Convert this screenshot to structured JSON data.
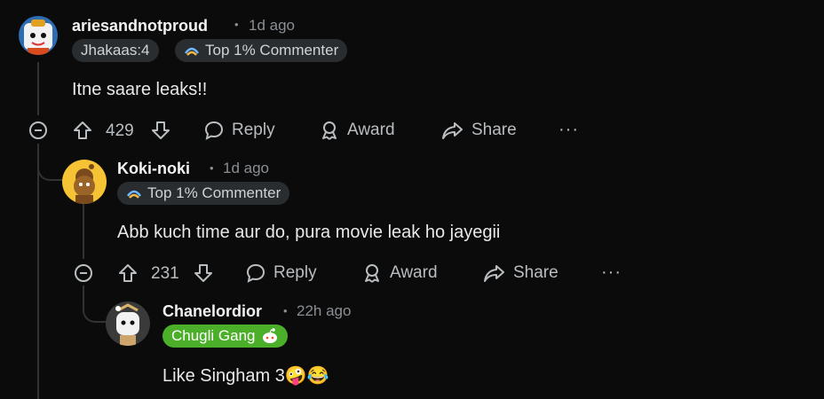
{
  "comments": [
    {
      "username": "ariesandnotproud",
      "separator": "•",
      "time": "1d ago",
      "flairs": [
        "Jhakaas:4",
        "Top 1% Commenter"
      ],
      "text": "Itne saare leaks!!",
      "votes": "429",
      "actions": {
        "reply": "Reply",
        "award": "Award",
        "share": "Share",
        "more": "···"
      }
    },
    {
      "username": "Koki-noki",
      "separator": "•",
      "time": "1d ago",
      "flairs": [
        "Top 1% Commenter"
      ],
      "text": "Abb kuch time aur do, pura movie leak ho jayegii",
      "votes": "231",
      "actions": {
        "reply": "Reply",
        "award": "Award",
        "share": "Share",
        "more": "···"
      }
    },
    {
      "username": "Chanelordior",
      "separator": "•",
      "time": "22h ago",
      "flairs": [
        "Chugli Gang"
      ],
      "text": "Like Singham 3🤪😂"
    }
  ],
  "colors": {
    "background": "#0b0b0b",
    "flair_bg": "#2a2d30",
    "green_flair": "#4caf2a",
    "thread_line": "#2f3336",
    "koki_avatar": "#f6c335"
  },
  "icons": {
    "upvote": "arrow-up-icon",
    "downvote": "arrow-down-icon",
    "reply": "speech-bubble-icon",
    "award": "award-ribbon-icon",
    "share": "share-arrow-icon",
    "collapse": "collapse-minus-icon",
    "top_commenter": "top-commenter-icon",
    "snoo": "snoo-icon"
  }
}
